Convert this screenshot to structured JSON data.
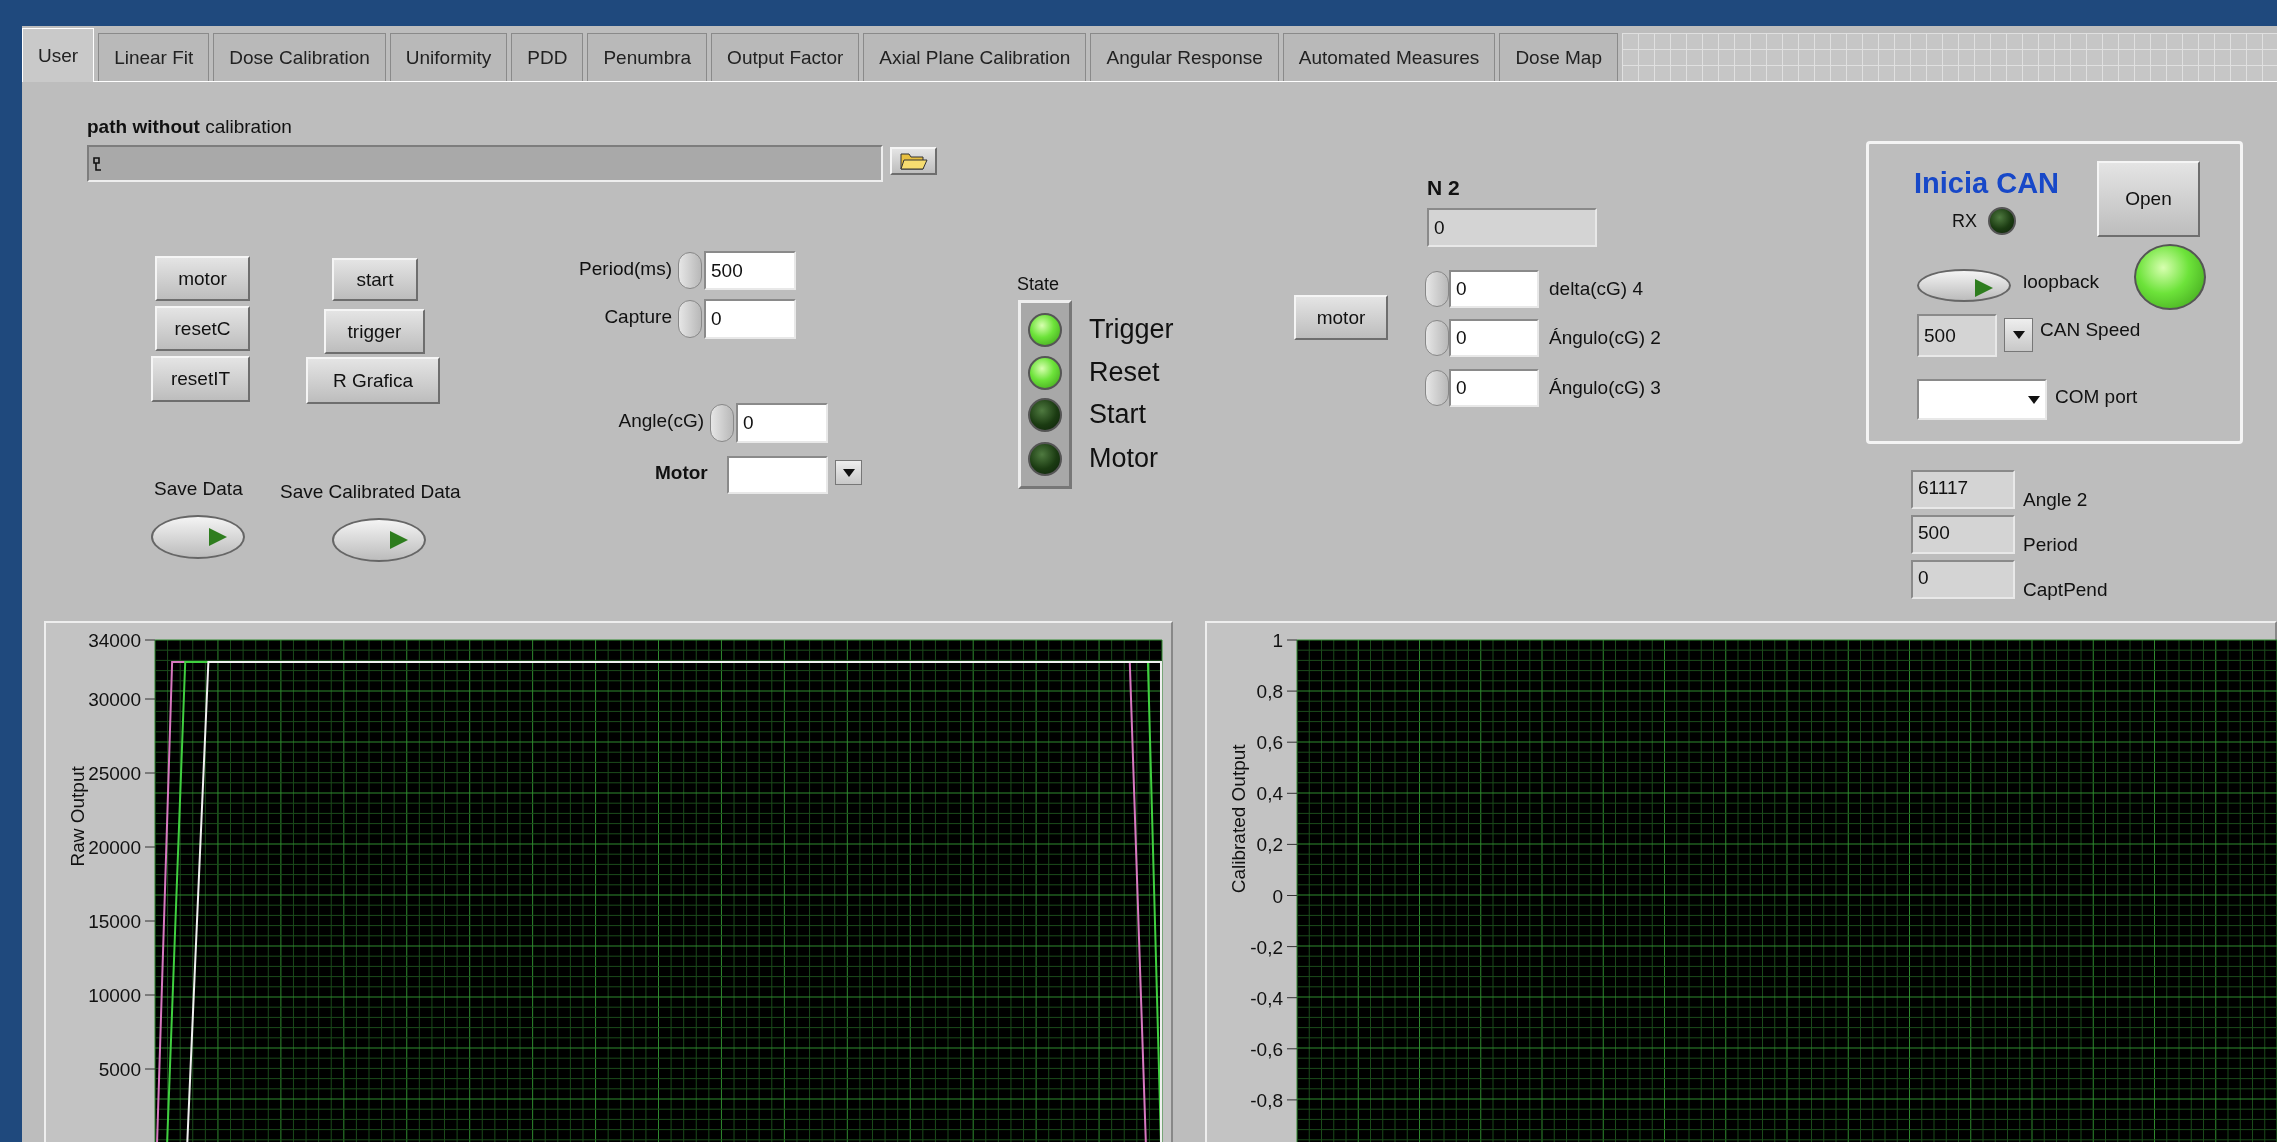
{
  "tabs": [
    {
      "label": "User",
      "selected": true
    },
    {
      "label": "Linear Fit",
      "selected": false
    },
    {
      "label": "Dose Calibration",
      "selected": false
    },
    {
      "label": "Uniformity",
      "selected": false
    },
    {
      "label": "PDD",
      "selected": false
    },
    {
      "label": "Penumbra",
      "selected": false
    },
    {
      "label": "Output Factor",
      "selected": false
    },
    {
      "label": "Axial Plane Calibration",
      "selected": false
    },
    {
      "label": "Angular Response",
      "selected": false
    },
    {
      "label": "Automated Measures",
      "selected": false
    },
    {
      "label": "Dose Map",
      "selected": false
    }
  ],
  "path_control": {
    "label": "**path without** calibration"
  },
  "buttons": [
    {
      "label": "motor"
    },
    {
      "label": "resetC"
    },
    {
      "label": "resetIT"
    },
    {
      "label": "start"
    },
    {
      "label": "trigger"
    },
    {
      "label": "R Grafica"
    }
  ],
  "numeric_controls": [
    {
      "label": "Period(ms)",
      "value": "500"
    },
    {
      "label": "Capture",
      "value": "0"
    },
    {
      "label": "Angle(cG)",
      "value": "0"
    }
  ],
  "motor_ring": {
    "label": "Motor"
  },
  "save_toggles": [
    {
      "label": "Save Data",
      "on": false
    },
    {
      "label": "Save Calibrated Data",
      "on": false
    }
  ],
  "state_leds": {
    "label": "State",
    "items": [
      {
        "label": "Trigger",
        "on": true
      },
      {
        "label": "Reset",
        "on": true
      },
      {
        "label": "Start",
        "on": false
      },
      {
        "label": "Motor",
        "on": false
      }
    ]
  },
  "motor_button": {
    "label": "motor"
  },
  "n2": {
    "label": "N 2",
    "value": "0"
  },
  "spinners": [
    {
      "value": "0",
      "label": "delta(cG) 4"
    },
    {
      "value": "0",
      "label": "Ángulo(cG) 2"
    },
    {
      "value": "0",
      "label": "Ángulo(cG) 3"
    }
  ],
  "can_panel": {
    "title": "Inicia CAN",
    "rx": {
      "label": "RX",
      "on": false
    },
    "open_button": "Open",
    "loopback": {
      "label": "loopback",
      "on": false
    },
    "status_led": {
      "on": true
    },
    "can_speed": {
      "value": "500",
      "label": "CAN Speed"
    },
    "com_port": {
      "label": "COM port"
    }
  },
  "indicators": [
    {
      "value": "61117",
      "label": "Angle 2"
    },
    {
      "value": "500",
      "label": "Period"
    },
    {
      "value": "0",
      "label": "CaptPend"
    }
  ],
  "graphs": [
    {
      "y_axis_title": "Raw Output",
      "y_tick_labels": [
        "34000",
        "30000",
        "25000",
        "20000",
        "15000",
        "10000",
        "5000"
      ],
      "kind": "traces"
    },
    {
      "y_axis_title": "Calibrated Output",
      "y_tick_labels": [
        "1",
        "0,8",
        "0,6",
        "0,4",
        "0,2",
        "0",
        "-0,2",
        "-0,4",
        "-0,6",
        "-0,8"
      ],
      "kind": "empty"
    }
  ]
}
